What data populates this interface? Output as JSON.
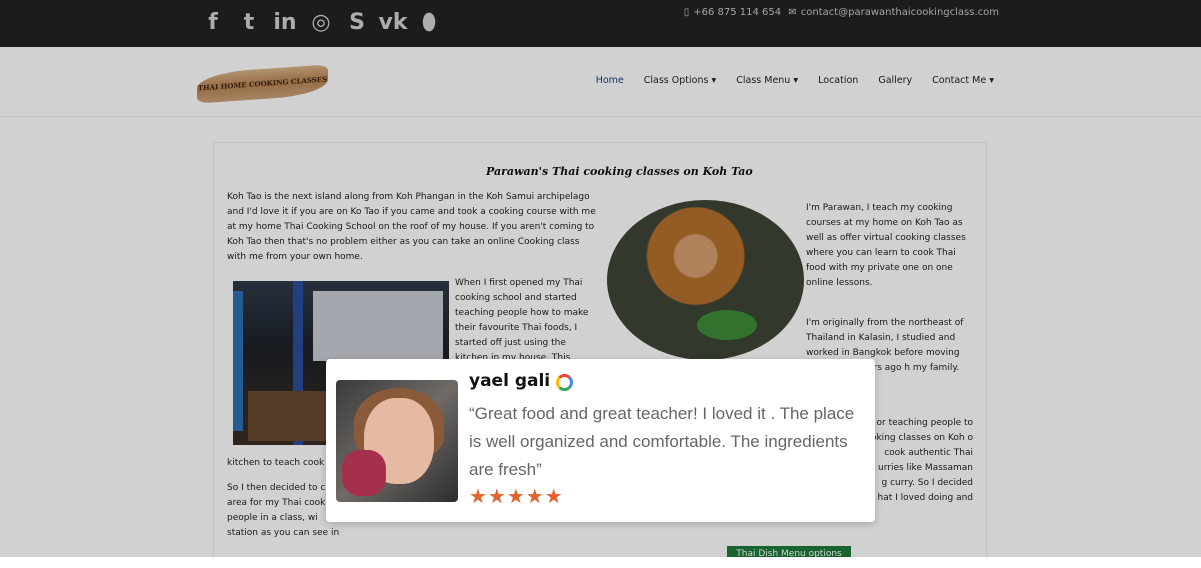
{
  "topbar": {
    "social_icons": [
      "facebook-icon",
      "twitter-icon",
      "linkedin-icon",
      "instagram-icon",
      "skype-icon",
      "vk-icon",
      "location-icon"
    ],
    "phone": "+66 875 114 654",
    "email": "contact@parawanthaicookingclass.com"
  },
  "nav": {
    "logo_text": "THAI HOME COOKING CLASSES",
    "items": [
      "Home",
      "Class Options",
      "Class Menu",
      "Location",
      "Gallery",
      "Contact Me"
    ],
    "active": "Home"
  },
  "content": {
    "title": "Parawan's Thai cooking classes on Koh Tao",
    "para1": "Koh Tao is the next island along from Koh Phangan in the Koh Samui archipelago and I'd love it if you are on Ko Tao if you came and took a cooking course with me at my home Thai Cooking School on the roof of my house. If you aren't coming to Koh Tao then that's no problem either as you can take an online Cooking class with me from your own home.",
    "para2": "When I first opened my Thai cooking school and started teaching people how to make their favourite Thai foods, I started off just using the kitchen in my house. This",
    "para3": "kitchen to teach cook",
    "para4": "So I then decided to c area for my Thai cook 6 people in a class, wi station as you can see in the picture (click it to enlarge).",
    "para5": "I'm Parawan, I teach my cooking courses at my home on Koh Tao as well as offer virtual cooking classes where you can learn to cook Thai food with my private one on one online lessons.",
    "para6": "I'm originally from the northeast of Thailand in Kalasin, I studied and worked in Bangkok before moving ao over 10 years ago h my family.",
    "para7": "or teaching people to oking classes on Koh o cook authentic Thai urries like Massaman g curry. So I decided hat I loved doing and",
    "menu_button": "Thai Dish Menu options"
  },
  "review": {
    "name": "yael gali",
    "icon": "google-icon",
    "text": "“Great food and great teacher! I loved it . The place is well organized and comfortable. The ingredients are fresh”",
    "rating": 5,
    "stars": "★★★★★"
  }
}
